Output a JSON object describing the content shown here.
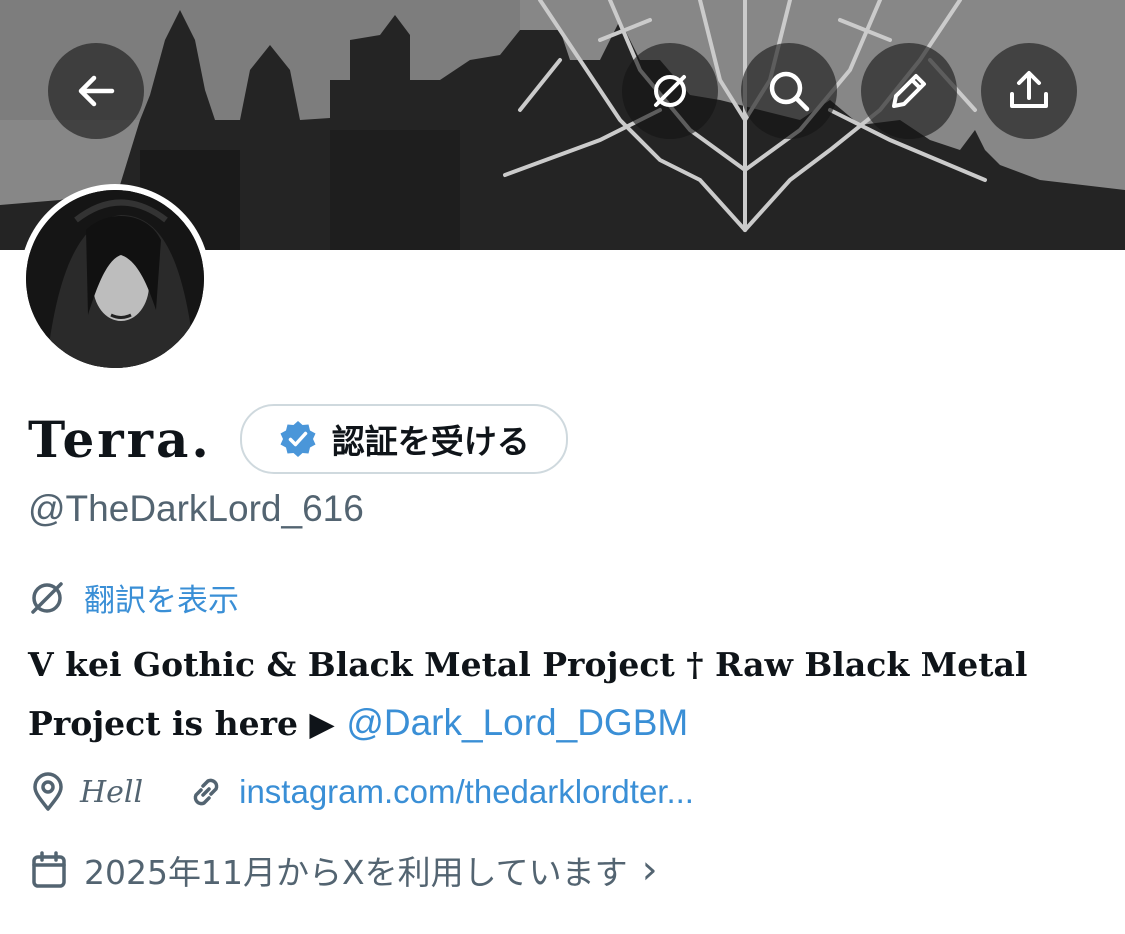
{
  "colors": {
    "accent_link": "#3a8fd6",
    "verified_blue": "#1d9bf0",
    "secondary_text": "#536471",
    "header_button_bg": "rgba(20,20,20,0.6)"
  },
  "header": {
    "back_icon": "arrow-left-icon",
    "actions": [
      {
        "icon": "translate-icon"
      },
      {
        "icon": "search-icon"
      },
      {
        "icon": "pencil-icon"
      },
      {
        "icon": "share-icon"
      }
    ]
  },
  "profile": {
    "display_name": "Terra.",
    "verify_button_label": "認証を受ける",
    "handle": "@TheDarkLord_616",
    "translate_label": "翻訳を表示",
    "bio_text": "V kei Gothic & Black Metal Project † Raw Black Metal Project is here ▶ ",
    "bio_mention": "@Dark_Lord_DGBM",
    "location": "Hell",
    "website": "instagram.com/thedarklordter...",
    "joined": "2025年11月からXを利用しています",
    "joined_chevron": "›"
  }
}
